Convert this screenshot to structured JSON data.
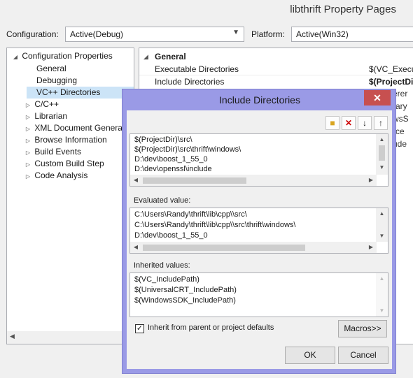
{
  "window": {
    "title": "libthrift Property Pages",
    "configuration_label": "Configuration:",
    "configuration_value": "Active(Debug)",
    "platform_label": "Platform:",
    "platform_value": "Active(Win32)"
  },
  "tree": {
    "root": "Configuration Properties",
    "items": [
      "General",
      "Debugging",
      "VC++ Directories",
      "C/C++",
      "Librarian",
      "XML Document Generat",
      "Browse Information",
      "Build Events",
      "Custom Build Step",
      "Code Analysis"
    ],
    "selected": "VC++ Directories"
  },
  "grid": {
    "section": "General",
    "rows": [
      {
        "name": "Executable Directories",
        "value": "$(VC_Executa"
      },
      {
        "name": "Include Directories",
        "value": "$(ProjectDir"
      }
    ],
    "truncated": [
      "erer",
      "rary",
      "wsS",
      "rce",
      "ude"
    ]
  },
  "dialog": {
    "title": "Include Directories",
    "close": "✕",
    "entries": [
      "$(ProjectDir)\\src\\",
      "$(ProjectDir)\\src\\thrift\\windows\\",
      "D:\\dev\\boost_1_55_0",
      "D:\\dev\\openssl\\include"
    ],
    "evaluated_label": "Evaluated value:",
    "evaluated": [
      "C:\\Users\\Randy\\thrift\\lib\\cpp\\\\src\\",
      "C:\\Users\\Randy\\thrift\\lib\\cpp\\\\src\\thrift\\windows\\",
      "D:\\dev\\boost_1_55_0"
    ],
    "inherited_label": "Inherited values:",
    "inherited": [
      "$(VC_IncludePath)",
      "$(UniversalCRT_IncludePath)",
      "$(WindowsSDK_IncludePath)"
    ],
    "inherit_checkbox_label": "Inherit from parent or project defaults",
    "inherit_checked": true,
    "macros_button": "Macros>>",
    "ok_button": "OK",
    "cancel_button": "Cancel"
  }
}
